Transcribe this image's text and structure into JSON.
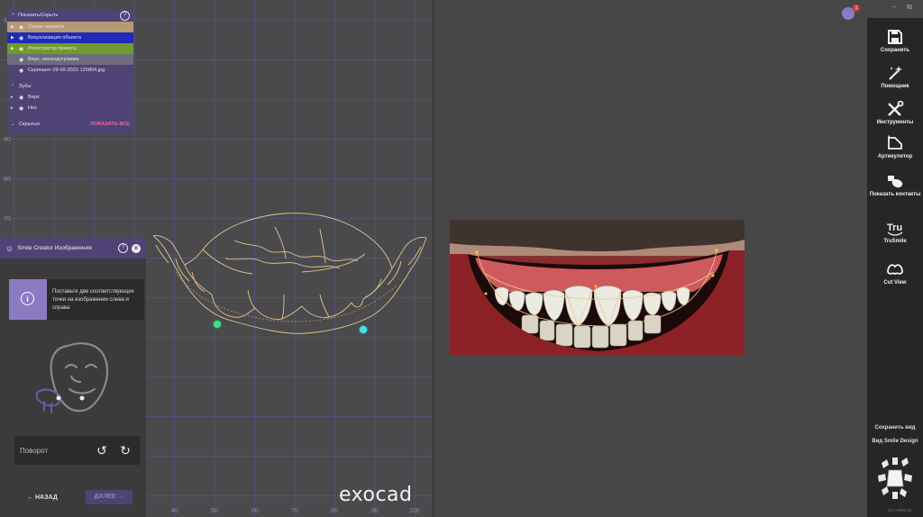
{
  "visibility_panel": {
    "title": "Показать/Скрыть",
    "items": [
      {
        "label": "Сканы челюсти",
        "color": "#b59a74"
      },
      {
        "label": "Визуализация объекта",
        "color": "#1f2ab8"
      },
      {
        "label": "Регистратор прикуса",
        "color": "#6f9a2c"
      },
      {
        "label": "Верх. окклюдограмма",
        "color": "#6c6c80"
      },
      {
        "label": "Скриншот 09-09-2022 125804.jpg",
        "color": ""
      }
    ],
    "teeth_section": "Зубы",
    "teeth_items": [
      "Верх",
      "Низ"
    ],
    "hidden_section": "Скрытые",
    "show_all": "ПОКАЗАТЬ ВСЕ"
  },
  "smile_panel": {
    "title": "Smile Creator Изображения",
    "instruction": "Поставьте две соответствующих точки на изображении слева и справа",
    "rotate_label": "Поворот",
    "back_label": "НАЗАД",
    "next_label": "ДАЛЕЕ"
  },
  "axes": {
    "y_ticks": [
      "100",
      "90",
      "80",
      "70",
      "60",
      "50",
      "40",
      "30",
      "20",
      "10"
    ],
    "x_ticks": [
      "10",
      "20",
      "30",
      "40",
      "50",
      "60",
      "70",
      "80",
      "90",
      "100"
    ],
    "x_unit": "mm",
    "axis_z": "Z"
  },
  "logo": "exocad",
  "notification_count": "1",
  "toolbar": {
    "tools": [
      {
        "label": "Сохранить",
        "icon": "save-icon"
      },
      {
        "label": "Помощник",
        "icon": "magic-wand-icon"
      },
      {
        "label": "Инструменты",
        "icon": "tools-icon"
      },
      {
        "label": "Артикулятор",
        "icon": "articulator-icon"
      },
      {
        "label": "Показать контакты",
        "icon": "contacts-icon"
      },
      {
        "label": "TruSmile",
        "icon": "trusmile-icon"
      },
      {
        "label": "Cut View",
        "icon": "cut-view-icon"
      }
    ],
    "save_view": "Сохранить вид",
    "smile_design_view": "Вид Smile Design"
  },
  "version": "v3.1-8296 64"
}
